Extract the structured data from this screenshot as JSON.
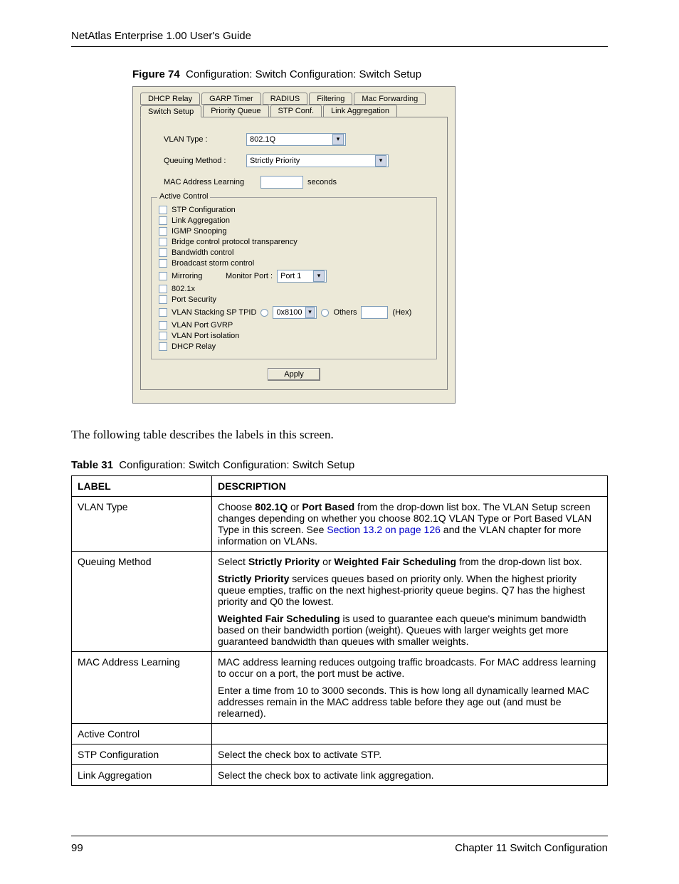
{
  "header": {
    "running_head": "NetAtlas Enterprise 1.00 User's Guide"
  },
  "figure": {
    "label": "Figure 74",
    "title": "Configuration: Switch Configuration: Switch Setup"
  },
  "dialog": {
    "tabs_back": [
      "DHCP Relay",
      "GARP Timer",
      "RADIUS",
      "Filtering",
      "Mac Forwarding"
    ],
    "tabs_front": [
      "Switch Setup",
      "Priority Queue",
      "STP Conf.",
      "Link Aggregation"
    ],
    "vlan_label": "VLAN Type :",
    "vlan_value": "802.1Q",
    "queuing_label": "Queuing Method :",
    "queuing_value": "Strictly Priority",
    "mac_label": "MAC Address Learning",
    "mac_value": "",
    "mac_unit": "seconds",
    "group_legend": "Active Control",
    "checks": [
      "STP Configuration",
      "Link Aggregation",
      "IGMP Snooping",
      "Bridge control protocol transparency",
      "Bandwidth control",
      "Broadcast storm control"
    ],
    "mirroring_label": "Mirroring",
    "monitor_label": "Monitor Port :",
    "monitor_value": "Port 1",
    "ieee_label": "802.1x",
    "port_sec_label": "Port Security",
    "vlan_stack_label": "VLAN Stacking SP TPID",
    "vlan_stack_value": "0x8100",
    "others_label": "Others",
    "hex_label": "(Hex)",
    "vlan_gvrp": "VLAN Port GVRP",
    "vlan_iso": "VLAN Port isolation",
    "dhcp_relay": "DHCP Relay",
    "apply": "Apply"
  },
  "body_text": "The following table describes the labels in this screen.",
  "table_caption": {
    "label": "Table 31",
    "title": "Configuration: Switch Configuration: Switch Setup"
  },
  "table": {
    "head_label": "LABEL",
    "head_desc": "DESCRIPTION",
    "rows": {
      "vlan_type": {
        "label": "VLAN Type",
        "pre": "Choose ",
        "b1": "802.1Q",
        "mid1": " or ",
        "b2": "Port Based",
        "post1": " from the drop-down list box. The VLAN Setup screen changes depending on whether you choose 802.1Q VLAN Type or Port Based VLAN Type in this screen. See ",
        "link": "Section 13.2 on page 126",
        "post2": " and the VLAN chapter for more information on VLANs."
      },
      "queuing": {
        "label": "Queuing Method",
        "p1_a": "Select ",
        "p1_b1": "Strictly Priority",
        "p1_mid": " or ",
        "p1_b2": "Weighted Fair Scheduling",
        "p1_c": " from the drop-down list box.",
        "p2_b": "Strictly Priority",
        "p2_txt": " services queues based on priority only. When the highest priority queue empties, traffic on the next highest-priority queue begins. Q7 has the highest priority and Q0 the lowest.",
        "p3_b": "Weighted Fair Scheduling",
        "p3_txt": " is used to guarantee each queue's minimum bandwidth based on their bandwidth portion (weight). Queues with larger weights get more guaranteed bandwidth than queues with smaller weights."
      },
      "mac": {
        "label": "MAC Address Learning",
        "p1": "MAC address learning reduces outgoing traffic broadcasts. For MAC address learning to occur on a port, the port must be active.",
        "p2": "Enter a time from 10 to 3000 seconds. This is how long all dynamically learned MAC addresses remain in the MAC address table before they age out (and must be relearned)."
      },
      "active": {
        "label": "Active Control",
        "desc": ""
      },
      "stp": {
        "label": "STP Configuration",
        "desc": "Select the check box to activate STP."
      },
      "link": {
        "label": "Link Aggregation",
        "desc": "Select the check box to activate link aggregation."
      }
    }
  },
  "footer": {
    "page": "99",
    "chapter": "Chapter 11 Switch Configuration"
  }
}
